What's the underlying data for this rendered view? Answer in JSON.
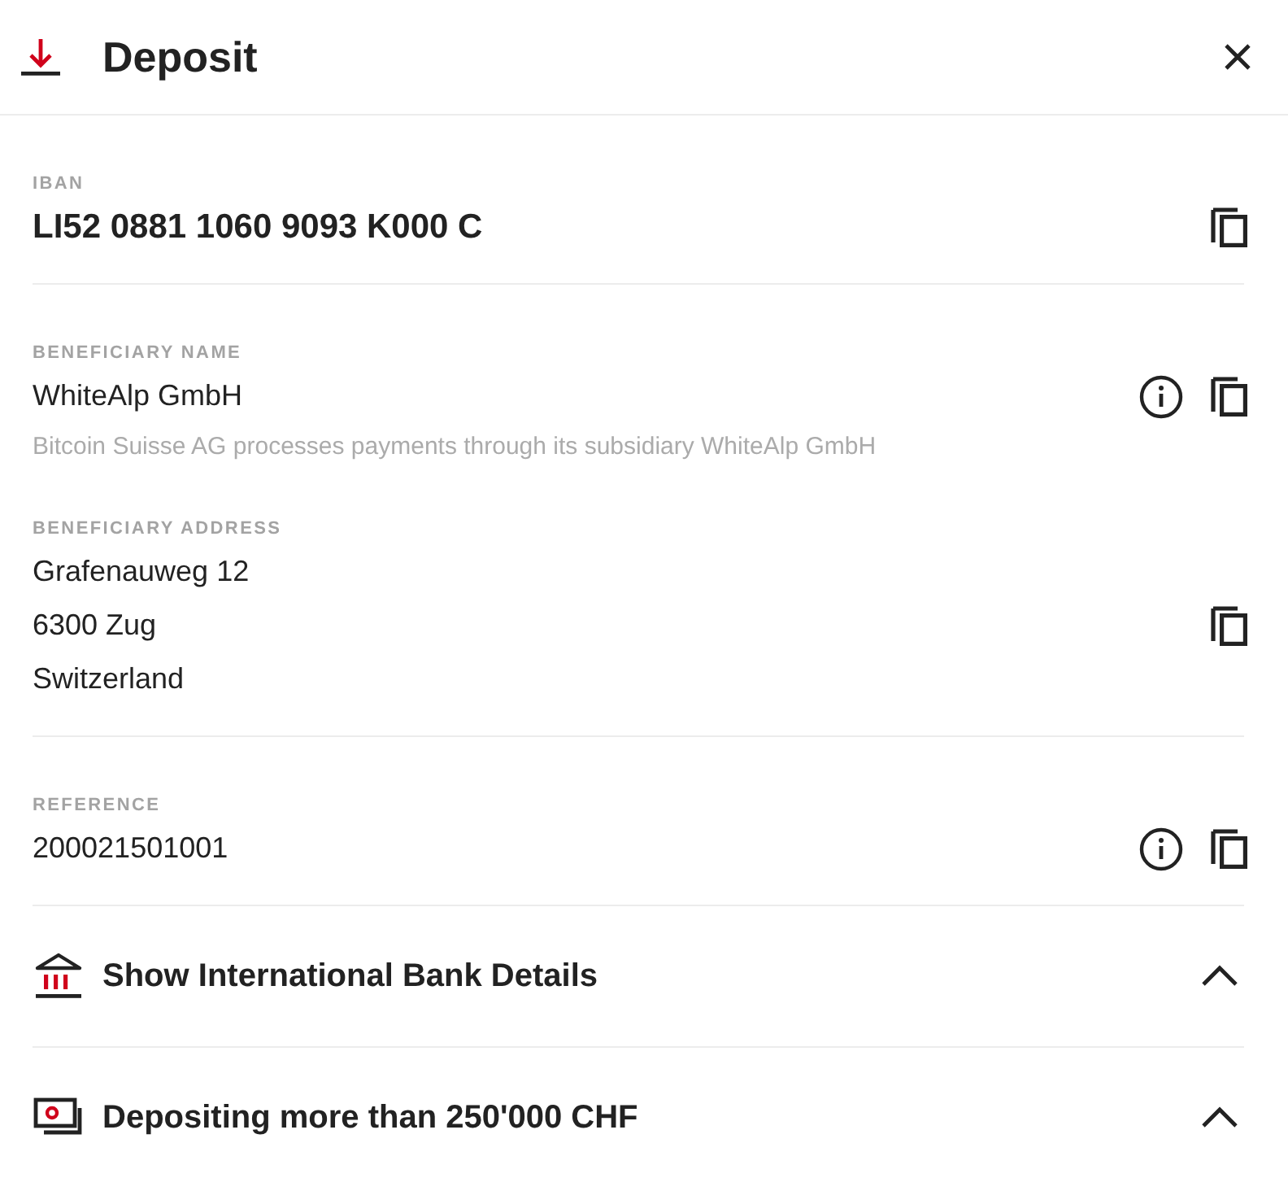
{
  "header": {
    "title": "Deposit"
  },
  "fields": [
    {
      "label": "IBAN",
      "lines": [
        "LI52 0881 1060 9093 K000 C"
      ],
      "emphasis": true,
      "info": false,
      "divider_after": true
    },
    {
      "label": "BENEFICIARY NAME",
      "lines": [
        "WhiteAlp GmbH"
      ],
      "note": "Bitcoin Suisse AG processes payments through its subsidiary WhiteAlp GmbH",
      "emphasis": false,
      "info": true,
      "divider_after": false
    },
    {
      "label": "BENEFICIARY ADDRESS",
      "lines": [
        "Grafenauweg 12",
        "6300 Zug",
        "Switzerland"
      ],
      "emphasis": false,
      "info": false,
      "divider_after": true
    },
    {
      "label": "REFERENCE",
      "lines": [
        "200021501001"
      ],
      "emphasis": false,
      "info": true,
      "divider_after": true
    }
  ],
  "sections": [
    {
      "kind": "bank",
      "label": "Show International Bank Details"
    },
    {
      "kind": "banknote",
      "label": "Depositing more than 250'000 CHF"
    }
  ]
}
